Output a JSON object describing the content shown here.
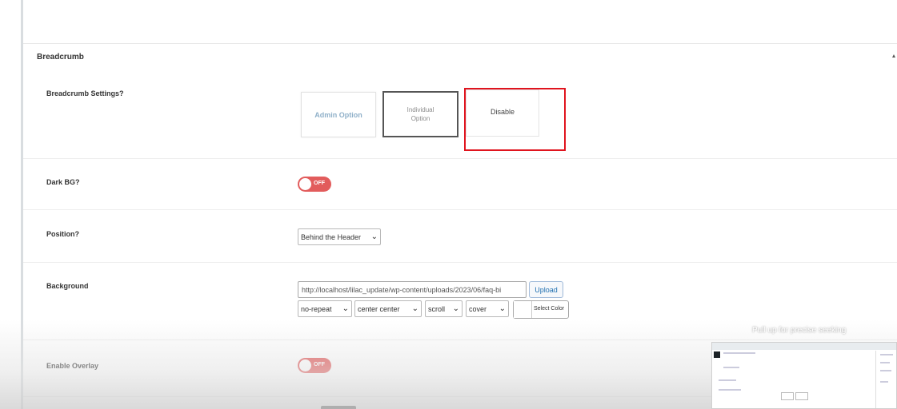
{
  "section": {
    "title": "Breadcrumb"
  },
  "breadcrumb_settings": {
    "label": "Breadcrumb Settings?",
    "options": [
      {
        "label": "Admin Option"
      },
      {
        "label": "Individual Option"
      },
      {
        "label": "Disable"
      }
    ],
    "selected": "Individual Option"
  },
  "dark_bg": {
    "label": "Dark BG?",
    "toggle_text": "OFF",
    "state": "off"
  },
  "position": {
    "label": "Position?",
    "value": "Behind the Header"
  },
  "background": {
    "label": "Background",
    "url_value": "http://localhost/lilac_update/wp-content/uploads/2023/06/faq-bi",
    "upload_label": "Upload",
    "repeat": "no-repeat",
    "position": "center center",
    "attachment": "scroll",
    "size": "cover",
    "color_button": "Select Color"
  },
  "enable_overlay": {
    "label": "Enable Overlay",
    "toggle_text": "OFF",
    "state": "off"
  },
  "video_player": {
    "seek_hint": "Pull up for precise seeking"
  },
  "colors": {
    "toggle_off": "#e25c5c",
    "highlight": "#e0141e",
    "link": "#2271b1"
  }
}
